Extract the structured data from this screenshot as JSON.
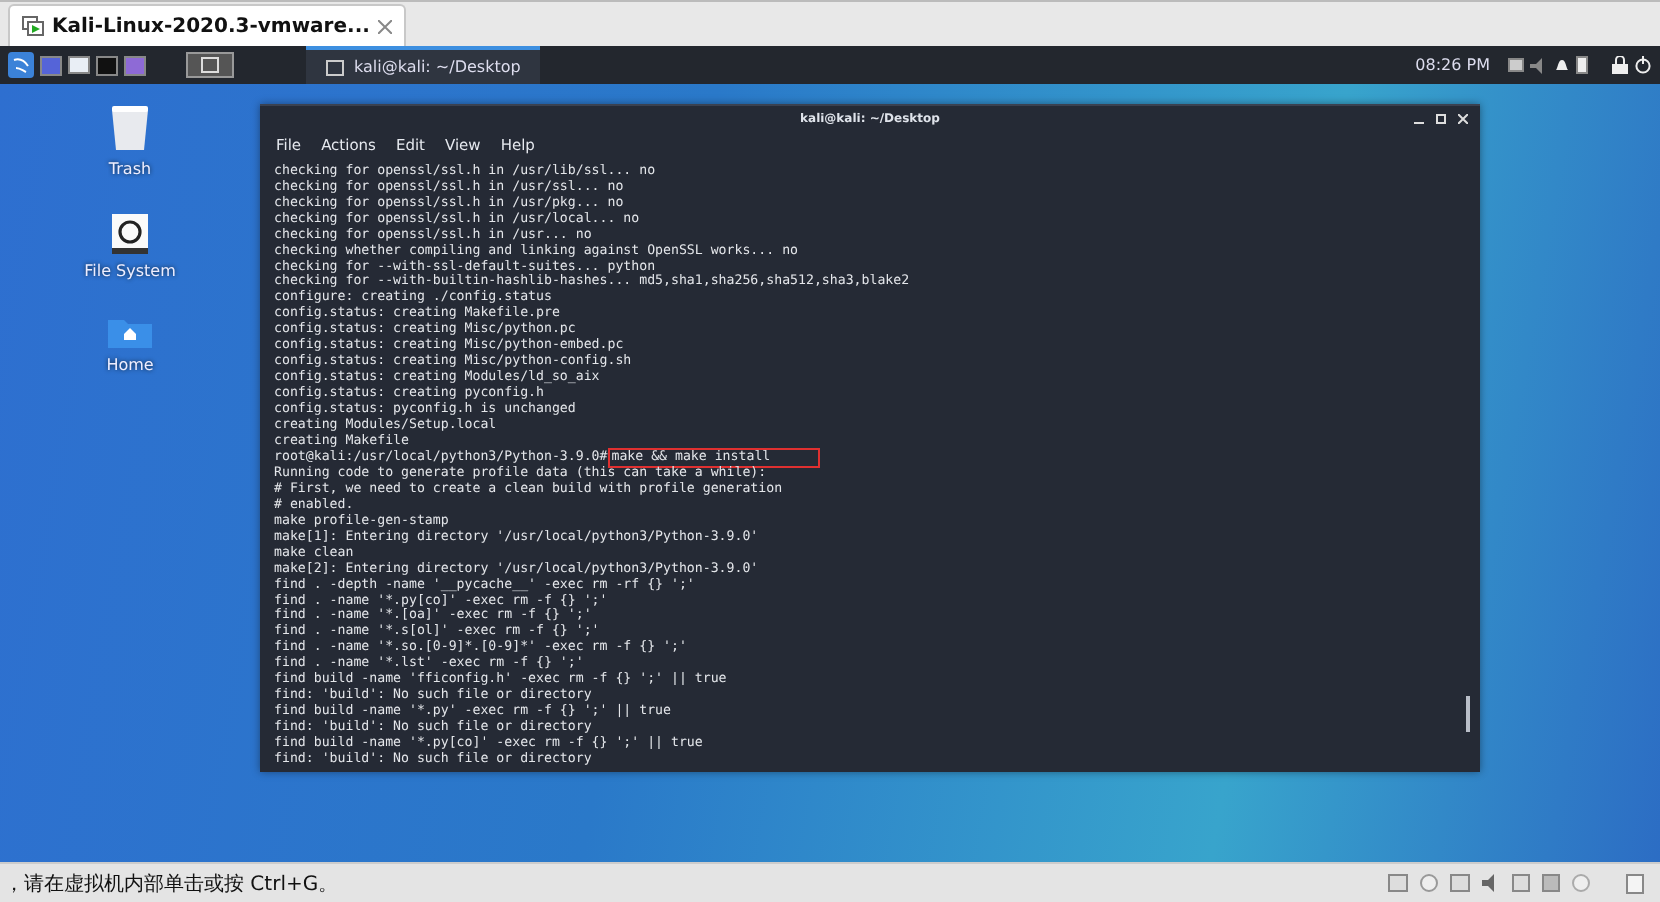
{
  "vm_tab": {
    "title": "Kali-Linux-2020.3-vmware...",
    "selected": true
  },
  "panel": {
    "window_buttons": [
      {
        "label": "kali@kali: ~/Desktop",
        "selected": true
      }
    ],
    "clock": "08:26 PM"
  },
  "desktop_icons": [
    {
      "kind": "trash",
      "label": "Trash"
    },
    {
      "kind": "drive",
      "label": "File System"
    },
    {
      "kind": "home",
      "label": "Home"
    }
  ],
  "terminal": {
    "title": "kali@kali: ~/Desktop",
    "menu": [
      "File",
      "Actions",
      "Edit",
      "View",
      "Help"
    ],
    "lines": [
      {
        "kind": "output",
        "text": "checking for openssl/ssl.h in /usr/lib/ssl... no"
      },
      {
        "kind": "output",
        "text": "checking for openssl/ssl.h in /usr/ssl... no"
      },
      {
        "kind": "output",
        "text": "checking for openssl/ssl.h in /usr/pkg... no"
      },
      {
        "kind": "output",
        "text": "checking for openssl/ssl.h in /usr/local... no"
      },
      {
        "kind": "output",
        "text": "checking for openssl/ssl.h in /usr... no"
      },
      {
        "kind": "output",
        "text": "checking whether compiling and linking against OpenSSL works... no"
      },
      {
        "kind": "output",
        "text": "checking for --with-ssl-default-suites... python"
      },
      {
        "kind": "output",
        "text": "checking for --with-builtin-hashlib-hashes... md5,sha1,sha256,sha512,sha3,blake2"
      },
      {
        "kind": "output",
        "text": "configure: creating ./config.status"
      },
      {
        "kind": "output",
        "text": "config.status: creating Makefile.pre"
      },
      {
        "kind": "output",
        "text": "config.status: creating Misc/python.pc"
      },
      {
        "kind": "output",
        "text": "config.status: creating Misc/python-embed.pc"
      },
      {
        "kind": "output",
        "text": "config.status: creating Misc/python-config.sh"
      },
      {
        "kind": "output",
        "text": "config.status: creating Modules/ld_so_aix"
      },
      {
        "kind": "output",
        "text": "config.status: creating pyconfig.h"
      },
      {
        "kind": "output",
        "text": "config.status: pyconfig.h is unchanged"
      },
      {
        "kind": "output",
        "text": "creating Modules/Setup.local"
      },
      {
        "kind": "output",
        "text": "creating Makefile"
      },
      {
        "kind": "prompt",
        "prompt": "root@kali:/usr/local/python3/Python-3.9.0#",
        "command": "make && make install",
        "highlighted": true
      },
      {
        "kind": "output",
        "text": "Running code to generate profile data (this can take a while):"
      },
      {
        "kind": "output",
        "text": "# First, we need to create a clean build with profile generation"
      },
      {
        "kind": "output",
        "text": "# enabled."
      },
      {
        "kind": "output",
        "text": "make profile-gen-stamp"
      },
      {
        "kind": "output",
        "text": "make[1]: Entering directory '/usr/local/python3/Python-3.9.0'"
      },
      {
        "kind": "output",
        "text": "make clean"
      },
      {
        "kind": "output",
        "text": "make[2]: Entering directory '/usr/local/python3/Python-3.9.0'"
      },
      {
        "kind": "output",
        "text": "find . -depth -name '__pycache__' -exec rm -rf {} ';'"
      },
      {
        "kind": "output",
        "text": "find . -name '*.py[co]' -exec rm -f {} ';'"
      },
      {
        "kind": "output",
        "text": "find . -name '*.[oa]' -exec rm -f {} ';'"
      },
      {
        "kind": "output",
        "text": "find . -name '*.s[ol]' -exec rm -f {} ';'"
      },
      {
        "kind": "output",
        "text": "find . -name '*.so.[0-9]*.[0-9]*' -exec rm -f {} ';'"
      },
      {
        "kind": "output",
        "text": "find . -name '*.lst' -exec rm -f {} ';'"
      },
      {
        "kind": "output",
        "text": "find build -name 'fficonfig.h' -exec rm -f {} ';' || true"
      },
      {
        "kind": "output",
        "text": "find: 'build': No such file or directory"
      },
      {
        "kind": "output",
        "text": "find build -name '*.py' -exec rm -f {} ';' || true"
      },
      {
        "kind": "output",
        "text": "find: 'build': No such file or directory"
      },
      {
        "kind": "output",
        "text": "find build -name '*.py[co]' -exec rm -f {} ';' || true"
      },
      {
        "kind": "output",
        "text": "find: 'build': No such file or directory"
      }
    ]
  },
  "status_bar": {
    "message": "，请在虚拟机内部单击或按 Ctrl+G。"
  }
}
